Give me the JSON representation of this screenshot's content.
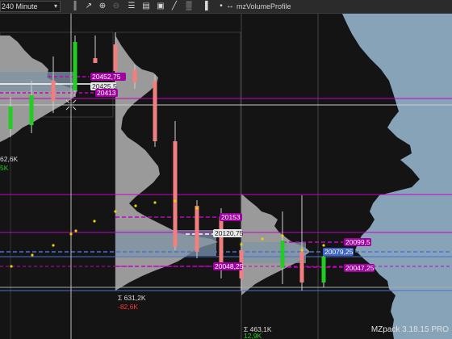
{
  "toolbar": {
    "timeframe": "240 Minute",
    "indicator": "mzVolumeProfile",
    "icons": [
      {
        "name": "bar-type-icon",
        "glyph": "║",
        "dim": false
      },
      {
        "name": "pointer-icon",
        "glyph": "↗",
        "dim": false
      },
      {
        "name": "zoom-in-icon",
        "glyph": "⊕",
        "dim": false
      },
      {
        "name": "zoom-out-icon",
        "glyph": "⊖",
        "dim": true
      },
      {
        "name": "properties-icon",
        "glyph": "☰",
        "dim": false
      },
      {
        "name": "templates-icon",
        "glyph": "▤",
        "dim": false
      },
      {
        "name": "screenshot-icon",
        "glyph": "▣",
        "dim": false
      },
      {
        "name": "drawing-tools-icon",
        "glyph": "╱",
        "dim": false
      },
      {
        "name": "indicators-icon",
        "glyph": "▒",
        "dim": false
      },
      {
        "name": "strategies-icon",
        "glyph": "▐",
        "dim": false
      },
      {
        "name": "more-icon",
        "glyph": "•",
        "dim": false
      },
      {
        "name": "arrows-icon",
        "glyph": "↔",
        "dim": false
      }
    ]
  },
  "chart": {
    "watermark": "MZpack 3.18.15 PRO",
    "price_labels": [
      {
        "text": "20452,75",
        "style": "magenta"
      },
      {
        "text": "20425,5",
        "style": "white"
      },
      {
        "text": "20413",
        "style": "magenta"
      },
      {
        "text": "20153",
        "style": "magenta"
      },
      {
        "text": "20120,75",
        "style": "white"
      },
      {
        "text": "20099,5",
        "style": "magenta"
      },
      {
        "text": "20079,25",
        "style": "blue"
      },
      {
        "text": "20048,25",
        "style": "magenta"
      },
      {
        "text": "20047,25",
        "style": "magenta"
      }
    ],
    "stats": [
      {
        "text": "62,6K",
        "color": "#dddddd"
      },
      {
        "text": "5K",
        "color": "#22cc22"
      },
      {
        "text": "Σ 631,2K",
        "color": "#dddddd"
      },
      {
        "text": "-82,6K",
        "color": "#ff3333"
      },
      {
        "text": "Σ 463,1K",
        "color": "#dddddd"
      },
      {
        "text": "12,9K",
        "color": "#22cc22"
      }
    ],
    "colors": {
      "bull": "#22cc22",
      "bear": "#f08080",
      "profile": "#9a9a9a",
      "profile_value_area": "#7d93a4",
      "right_profile": "#86a3b8",
      "magenta": "#c800c8",
      "poc": "#4a6fd8"
    }
  }
}
